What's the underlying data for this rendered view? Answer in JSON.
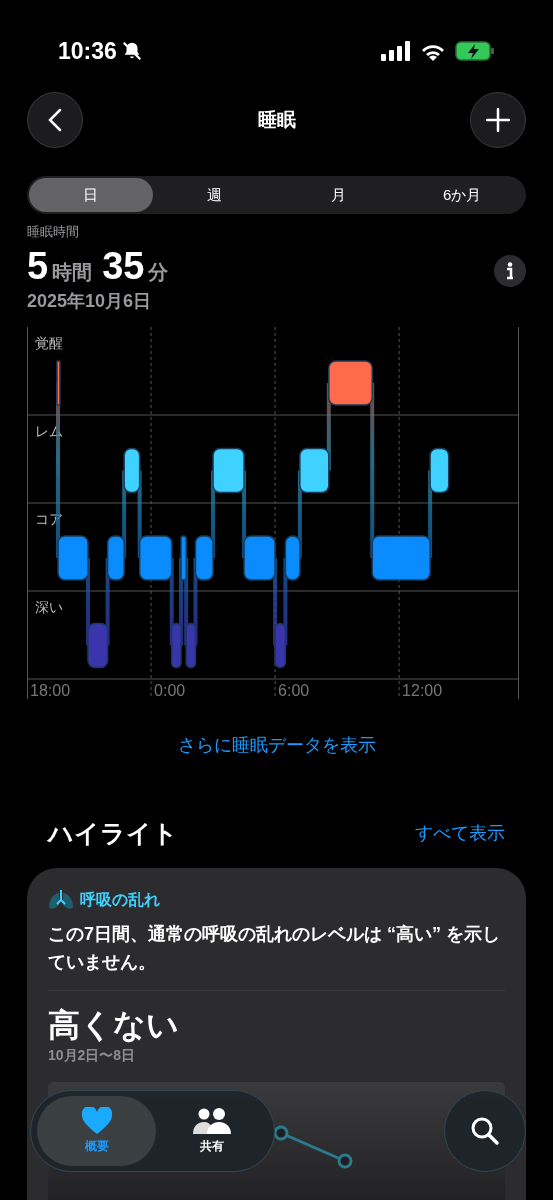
{
  "status_bar": {
    "time": "10:36"
  },
  "nav": {
    "title": "睡眠"
  },
  "tabs": [
    {
      "label": "日",
      "selected": true
    },
    {
      "label": "週",
      "selected": false
    },
    {
      "label": "月",
      "selected": false
    },
    {
      "label": "6か月",
      "selected": false
    }
  ],
  "summary": {
    "label": "睡眠時間",
    "hours": "5",
    "hours_unit": "時間",
    "minutes": "35",
    "minutes_unit": "分",
    "date": "2025年10月6日"
  },
  "sleep_chart": {
    "stage_labels": [
      "覚醒",
      "レム",
      "コア",
      "深い"
    ],
    "time_labels": [
      "18:00",
      "0:00",
      "6:00",
      "12:00"
    ]
  },
  "more_link": "さらに睡眠データを表示",
  "highlights": {
    "title": "ハイライト",
    "show_all": "すべて表示",
    "card": {
      "category": "呼吸の乱れ",
      "message": "この7日間、通常の呼吸の乱れのレベルは “高い” を示していません。",
      "result": "高くない",
      "range": "10月2日〜8日"
    }
  },
  "tab_bar": [
    {
      "label": "概要",
      "kind": "heart",
      "selected": true
    },
    {
      "label": "共有",
      "kind": "people",
      "selected": false
    }
  ]
}
